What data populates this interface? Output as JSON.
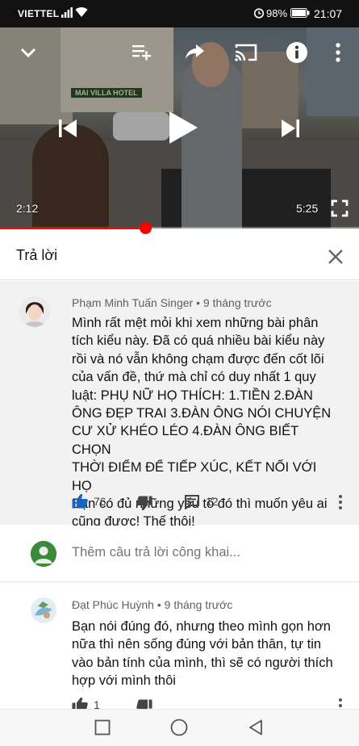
{
  "status_bar": {
    "carrier": "VIETTEL",
    "battery_percent": "98%",
    "clock": "21:07"
  },
  "video": {
    "hotel_sign": "MAI VILLA HOTEL",
    "current_time": "2:12",
    "duration": "5:25",
    "progress_fraction": 0.405,
    "icons": [
      "chevron-down-icon",
      "add-to-playlist-icon",
      "share-icon",
      "cast-icon",
      "info-icon",
      "more-vert-icon",
      "previous-icon",
      "play-icon",
      "next-icon",
      "fullscreen-icon"
    ]
  },
  "reply_panel": {
    "title": "Trả lời"
  },
  "parent_comment": {
    "author": "Phạm Minh Tuấn Singer",
    "time": "9 tháng trước",
    "lines": [
      "Mình rất mệt mỏi khi xem những bài phân",
      "tích kiểu này. Đã có quá nhiều bài kiểu này",
      "rồi và nó vẫn không chạm được đến cốt lõi",
      "của vấn đề, thứ mà chỉ có duy nhất 1 quy",
      "luật: PHỤ NỮ HỌ THÍCH: 1.TIỀN 2.ĐÀN",
      "ÔNG ĐẸP TRAI 3.ĐÀN ÔNG NÓI CHUYỆN",
      "CƯ XỬ KHÉO LÉO 4.ĐÀN ÔNG BIẾT CHỌN",
      "THỜI ĐIỂM ĐỂ TIẾP XÚC, KẾT NỐI VỚI HỌ",
      "Bạn có đủ những yếu tố đó thì muốn yêu ai",
      "cũng được! Thế thôi!"
    ],
    "likes": "76",
    "replies": "12"
  },
  "add_reply": {
    "placeholder": "Thêm câu trả lời công khai..."
  },
  "reply_comment": {
    "author": "Đạt Phúc Huỳnh",
    "time": "9 tháng trước",
    "lines": [
      "Bạn nói đúng đó, nhưng theo mình gọn hơn",
      "nữa thì nên sống đúng với bản thân, tự tin",
      "vào bản tính của mình, thì sẽ có người thích",
      "hợp với mình thôi"
    ],
    "likes": "1"
  },
  "colors": {
    "accent_blue": "#1565c0",
    "progress_red": "#ff0000",
    "text": "#111111",
    "meta": "#606060"
  }
}
